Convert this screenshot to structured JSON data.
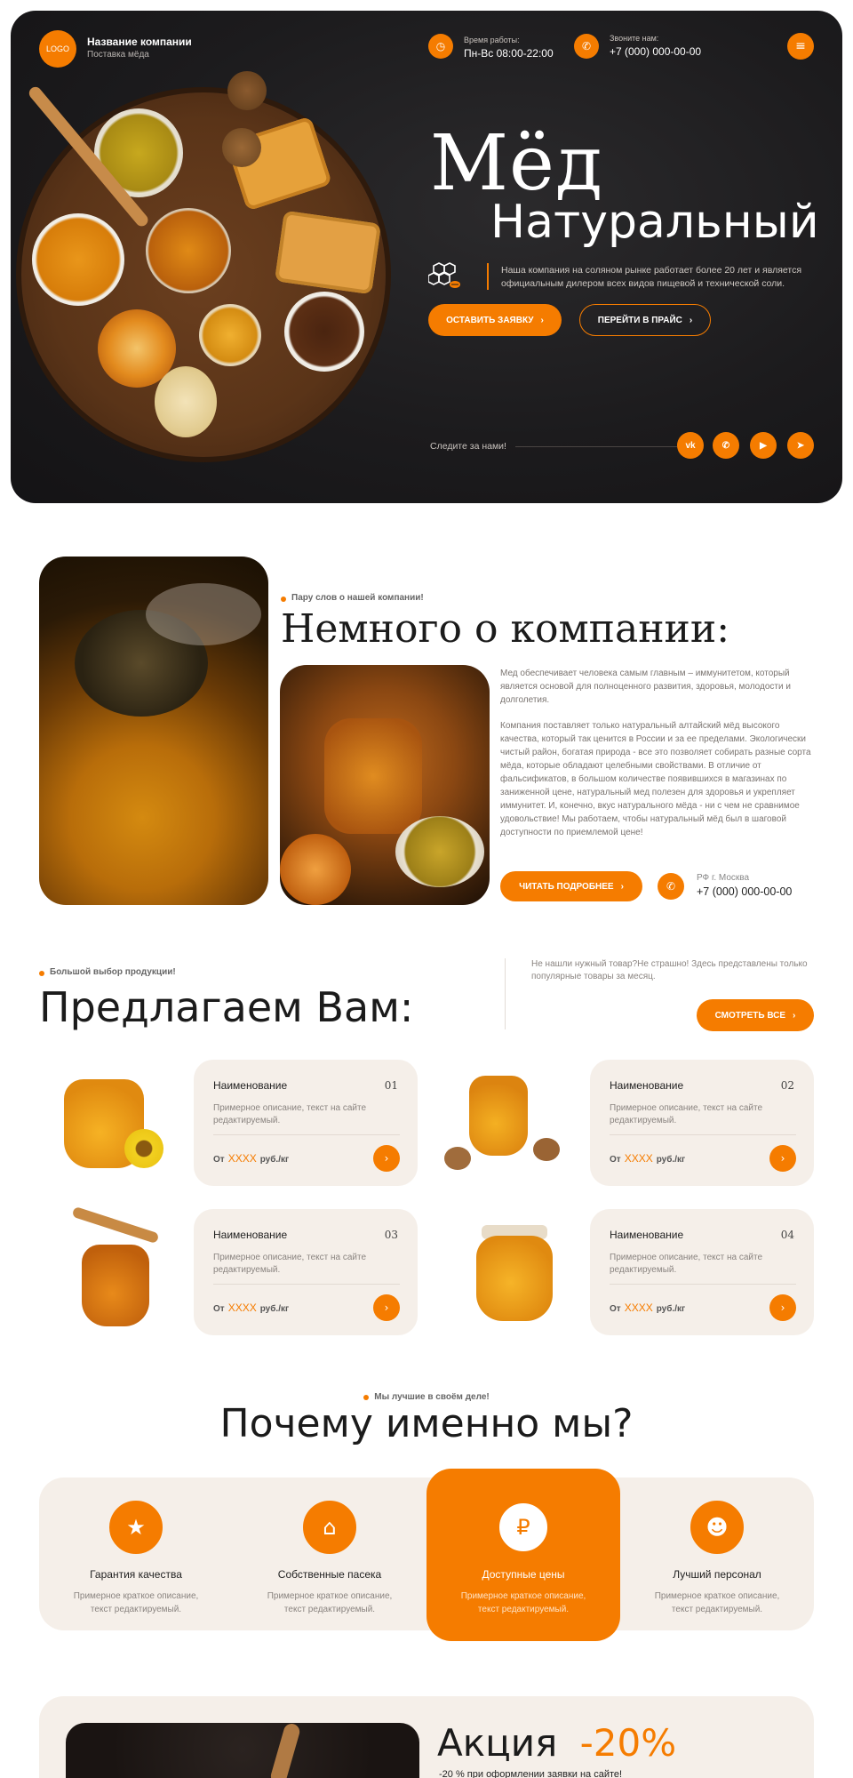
{
  "header": {
    "logo": "LOGO",
    "company_name": "Название компании",
    "company_sub": "Поставка мёда",
    "hours_label": "Время работы:",
    "hours_value": "Пн-Вс 08:00-22:00",
    "call_label": "Звоните нам:",
    "call_value": "+7 (000) 000-00-00",
    "menu_icon": "menu-icon"
  },
  "hero": {
    "title1": "Мёд",
    "title2": "Натуральный",
    "description": "Наша компания на соляном рынке работает более 20 лет и является официальным дилером всех видов пищевой и технической соли.",
    "btn_request": "ОСТАВИТЬ ЗАЯВКУ",
    "btn_price": "ПЕРЕЙТИ В ПРАЙС",
    "follow": "Следите за нами!",
    "socials": [
      "vk",
      "whatsapp",
      "youtube",
      "telegram"
    ]
  },
  "about": {
    "kicker": "Пару слов о нашей компании!",
    "title": "Немного о компании:",
    "p1": "Мед обеспечивает человека самым главным – иммунитетом, который является основой для полноценного развития, здоровья, молодости и долголетия.",
    "p2": "Компания поставляет только натуральный алтайский мёд высокого качества, который так ценится в России и за ее пределами. Экологически чистый район, богатая природа - все это позволяет собирать разные сорта мёда, которые обладают целебными свойствами. В отличие от фальсификатов, в большом количестве появившихся в магазинах по заниженной цене, натуральный мед полезен для здоровья и укрепляет иммунитет. И, конечно, вкус натурального мёда - ни с чем не сравнимое удовольствие! Мы работаем, чтобы натуральный мёд был в шаговой доступности по приемлемой цене!",
    "btn_more": "ЧИТАТЬ ПОДРОБНЕЕ",
    "city": "РФ г. Москва",
    "phone": "+7 (000) 000-00-00"
  },
  "products": {
    "kicker": "Большой выбор продукции!",
    "title": "Предлагаем Вам:",
    "note": "Не нашли нужный товар?Не страшно! Здесь представлены только популярные товары за месяц.",
    "btn_all": "СМОТРЕТЬ ВСЕ",
    "items": [
      {
        "name": "Наименование",
        "num": "01",
        "desc": "Примерное описание, текст на сайте редактируемый.",
        "from": "От",
        "price": "XXXX",
        "unit": "руб./кг"
      },
      {
        "name": "Наименование",
        "num": "02",
        "desc": "Примерное описание, текст на сайте редактируемый.",
        "from": "От",
        "price": "XXXX",
        "unit": "руб./кг"
      },
      {
        "name": "Наименование",
        "num": "03",
        "desc": "Примерное описание, текст на сайте редактируемый.",
        "from": "От",
        "price": "XXXX",
        "unit": "руб./кг"
      },
      {
        "name": "Наименование",
        "num": "04",
        "desc": "Примерное описание, текст на сайте редактируемый.",
        "from": "От",
        "price": "XXXX",
        "unit": "руб./кг"
      }
    ]
  },
  "why": {
    "kicker": "Мы лучшие в своём деле!",
    "title": "Почему именно мы?",
    "features": [
      {
        "name": "Гарантия качества",
        "desc": "Примерное краткое описание, текст редактируемый.",
        "icon": "quality-icon"
      },
      {
        "name": "Собственные пасека",
        "desc": "Примерное краткое описание, текст редактируемый.",
        "icon": "apiary-icon"
      },
      {
        "name": "Доступные цены",
        "desc": "Примерное краткое описание, текст редактируемый.",
        "icon": "price-icon"
      },
      {
        "name": "Лучший персонал",
        "desc": "Примерное краткое описание, текст редактируемый.",
        "icon": "staff-icon"
      }
    ]
  },
  "promo": {
    "title": "Акция",
    "pct": "-20%",
    "sub": "-20 % при оформлении заявки на сайте!"
  },
  "colors": {
    "accent": "#f57c00",
    "dark": "#1c1b1d",
    "cream": "#f5efe9"
  }
}
